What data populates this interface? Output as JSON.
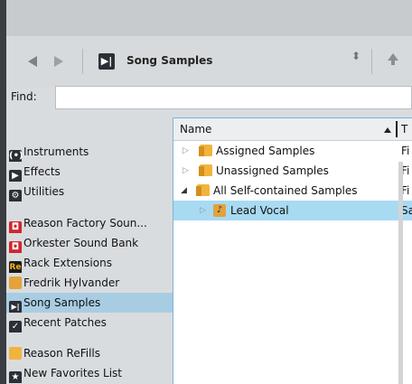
{
  "toolbar": {
    "location_title": "Song Samples",
    "stepper_glyph": "⬍",
    "location_icon_glyph": "▶|"
  },
  "find": {
    "label": "Find:",
    "value": ""
  },
  "sidebar": {
    "items": [
      {
        "label": "Instruments",
        "icon": "instrument-icon",
        "icon_glyph": "(•)",
        "color": "#2b2f36"
      },
      {
        "label": "Effects",
        "icon": "effects-icon",
        "icon_glyph": "▶",
        "color": "#2b2f36"
      },
      {
        "label": "Utilities",
        "icon": "utilities-icon",
        "icon_glyph": "⚙",
        "color": "#2b2f36"
      },
      {
        "label": "Reason Factory Soun...",
        "icon": "soundbank-icon",
        "icon_glyph": "◘",
        "color": "#d0262d"
      },
      {
        "label": "Orkester Sound Bank",
        "icon": "soundbank-icon",
        "icon_glyph": "◘",
        "color": "#d0262d"
      },
      {
        "label": "Rack Extensions",
        "icon": "re-icon",
        "icon_glyph": "Re",
        "color": "#1a1a1a"
      },
      {
        "label": "Fredrik Hylvander",
        "icon": "user-folder-icon",
        "icon_glyph": "",
        "color": "#e3a23a"
      },
      {
        "label": "Song Samples",
        "icon": "song-samples-icon",
        "icon_glyph": "▶|",
        "color": "#2b2f36"
      },
      {
        "label": "Recent Patches",
        "icon": "recent-icon",
        "icon_glyph": "✓",
        "color": "#2b2f36"
      },
      {
        "label": "Reason ReFills",
        "icon": "folder-icon",
        "icon_glyph": "",
        "color": "#f0b43c"
      },
      {
        "label": "New Favorites List",
        "icon": "star-icon",
        "icon_glyph": "★",
        "color": "#2b2f36"
      }
    ]
  },
  "browser": {
    "col_name": "Name",
    "col_type": "T",
    "rows": [
      {
        "label": "Assigned Samples",
        "type": "Fi",
        "expanded": false
      },
      {
        "label": "Unassigned Samples",
        "type": "Fi",
        "expanded": false
      },
      {
        "label": "All Self-contained Samples",
        "type": "Fi",
        "expanded": true
      },
      {
        "label": "Lead Vocal",
        "type": "Sa",
        "expanded": false
      }
    ]
  },
  "colors": {
    "selection_sidebar": "#a8cde3",
    "selection_list": "#a8daf2",
    "accent_border": "#7fb2d9"
  }
}
